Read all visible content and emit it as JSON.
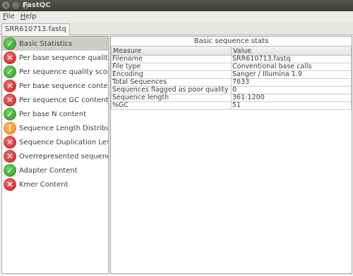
{
  "window": {
    "title": "FastQC",
    "buttons": [
      "close",
      "minimize",
      "maximize"
    ]
  },
  "menu": {
    "items": [
      {
        "label_u": "F",
        "label_rest": "ile"
      },
      {
        "label_u": "H",
        "label_rest": "elp"
      }
    ]
  },
  "tab": {
    "label": "SRR610713.fastq"
  },
  "modules": [
    {
      "label": "Basic Statistics",
      "status": "pass",
      "icon": "check-icon",
      "glyph": "✓"
    },
    {
      "label": "Per base sequence quality",
      "status": "fail",
      "icon": "cross-icon",
      "glyph": "✕"
    },
    {
      "label": "Per sequence quality scores",
      "status": "pass",
      "icon": "check-icon",
      "glyph": "✓"
    },
    {
      "label": "Per base sequence content",
      "status": "fail",
      "icon": "cross-icon",
      "glyph": "✕"
    },
    {
      "label": "Per sequence GC content",
      "status": "fail",
      "icon": "cross-icon",
      "glyph": "✕"
    },
    {
      "label": "Per base N content",
      "status": "pass",
      "icon": "check-icon",
      "glyph": "✓"
    },
    {
      "label": "Sequence Length Distribution",
      "status": "warn",
      "icon": "warning-icon",
      "glyph": "!"
    },
    {
      "label": "Sequence Duplication Levels",
      "status": "fail",
      "icon": "cross-icon",
      "glyph": "✕"
    },
    {
      "label": "Overrepresented sequences",
      "status": "fail",
      "icon": "cross-icon",
      "glyph": "✕"
    },
    {
      "label": "Adapter Content",
      "status": "pass",
      "icon": "check-icon",
      "glyph": "✓"
    },
    {
      "label": "Kmer Content",
      "status": "fail",
      "icon": "cross-icon",
      "glyph": "✕"
    }
  ],
  "selected_module": 0,
  "report": {
    "title": "Basic sequence stats",
    "columns": [
      "Measure",
      "Value"
    ],
    "rows": [
      [
        "Filename",
        "SRR610713.fastq"
      ],
      [
        "File type",
        "Conventional base calls"
      ],
      [
        "Encoding",
        "Sanger / Illumina 1.9"
      ],
      [
        "Total Sequences",
        "7633"
      ],
      [
        "Sequences flagged as poor quality",
        "0"
      ],
      [
        "Sequence length",
        "361-1200"
      ],
      [
        "%GC",
        "51"
      ]
    ]
  },
  "colors": {
    "pass": "#2e9a2a",
    "fail": "#c91f1f",
    "warn": "#ef8b0c",
    "selection": "#cfcdc9"
  }
}
